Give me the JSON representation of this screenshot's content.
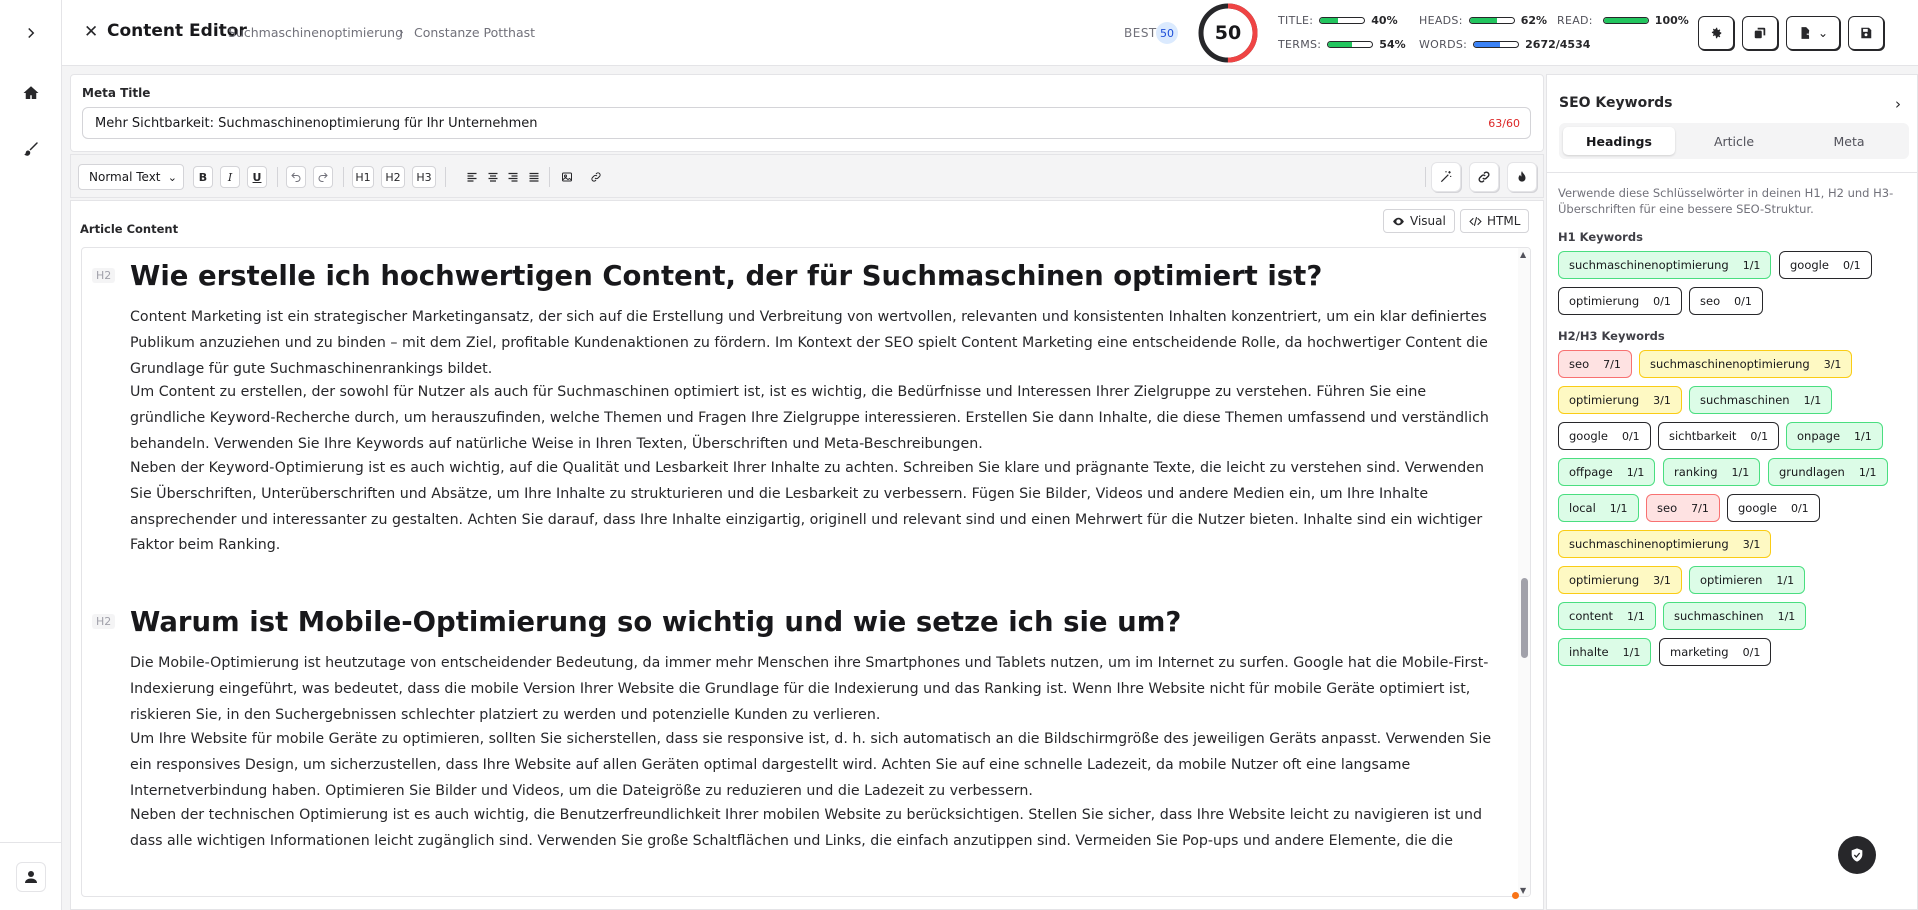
{
  "header": {
    "title": "Content Editor",
    "breadcrumb": [
      "Suchmaschinenoptimierung",
      "Constanze Potthast"
    ],
    "best_label": "BEST",
    "best_value": "50",
    "score": "50",
    "score_fraction": 0.5,
    "metrics": {
      "title": {
        "label": "TITLE:",
        "value": "40%",
        "fill": 0.4
      },
      "terms": {
        "label": "TERMS:",
        "value": "54%",
        "fill": 0.54
      },
      "heads": {
        "label": "HEADS:",
        "value": "62%",
        "fill": 0.62
      },
      "words": {
        "label": "WORDS:",
        "value": "2672/4534",
        "fill": 0.59
      },
      "read": {
        "label": "READ:",
        "value": "100%",
        "fill": 1.0
      }
    }
  },
  "meta": {
    "label": "Meta Title",
    "value": "Mehr Sichtbarkeit: Suchmaschinenoptimierung für Ihr Unternehmen",
    "count": "63/60"
  },
  "toolbar": {
    "style_select": "Normal Text",
    "bold": "B",
    "italic": "I",
    "underline": "U",
    "h1": "H1",
    "h2": "H2",
    "h3": "H3"
  },
  "article": {
    "label": "Article Content",
    "visual_label": "Visual",
    "html_label": "HTML",
    "sections": [
      {
        "tag": "H2",
        "heading": "Wie erstelle ich hochwertigen Content, der für Suchmaschinen optimiert ist?",
        "paragraphs": [
          "Content Marketing ist ein strategischer Marketingansatz, der sich auf die Erstellung und Verbreitung von wertvollen, relevanten und konsistenten Inhalten konzentriert, um ein klar definiertes Publikum anzuziehen und zu binden – mit dem Ziel, profitable Kundenaktionen zu fördern. Im Kontext der SEO spielt Content Marketing eine entscheidende Rolle, da hochwertiger Content die Grundlage für gute Suchmaschinenrankings bildet.",
          "Um Content zu erstellen, der sowohl für Nutzer als auch für Suchmaschinen optimiert ist, ist es wichtig, die Bedürfnisse und Interessen Ihrer Zielgruppe zu verstehen. Führen Sie eine gründliche Keyword-Recherche durch, um herauszufinden, welche Themen und Fragen Ihre Zielgruppe interessieren. Erstellen Sie dann Inhalte, die diese Themen umfassend und verständlich behandeln. Verwenden Sie Ihre Keywords auf natürliche Weise in Ihren Texten, Überschriften und Meta-Beschreibungen.",
          "Neben der Keyword-Optimierung ist es auch wichtig, auf die Qualität und Lesbarkeit Ihrer Inhalte zu achten. Schreiben Sie klare und prägnante Texte, die leicht zu verstehen sind. Verwenden Sie Überschriften, Unterüberschriften und Absätze, um Ihre Inhalte zu strukturieren und die Lesbarkeit zu verbessern. Fügen Sie Bilder, Videos und andere Medien ein, um Ihre Inhalte ansprechender und interessanter zu gestalten. Achten Sie darauf, dass Ihre Inhalte einzigartig, originell und relevant sind und einen Mehrwert für die Nutzer bieten. Inhalte sind ein wichtiger Faktor beim Ranking."
        ]
      },
      {
        "tag": "H2",
        "heading": "Warum ist Mobile-Optimierung so wichtig und wie setze ich sie um?",
        "paragraphs": [
          "Die Mobile-Optimierung ist heutzutage von entscheidender Bedeutung, da immer mehr Menschen ihre Smartphones und Tablets nutzen, um im Internet zu surfen. Google hat die Mobile-First-Indexierung eingeführt, was bedeutet, dass die mobile Version Ihrer Website die Grundlage für die Indexierung und das Ranking ist. Wenn Ihre Website nicht für mobile Geräte optimiert ist, riskieren Sie, in den Suchergebnissen schlechter platziert zu werden und potenzielle Kunden zu verlieren.",
          "Um Ihre Website für mobile Geräte zu optimieren, sollten Sie sicherstellen, dass sie responsive ist, d. h. sich automatisch an die Bildschirmgröße des jeweiligen Geräts anpasst. Verwenden Sie ein responsives Design, um sicherzustellen, dass Ihre Website auf allen Geräten optimal dargestellt wird. Achten Sie auf eine schnelle Ladezeit, da mobile Nutzer oft eine langsame Internetverbindung haben. Optimieren Sie Bilder und Videos, um die Dateigröße zu reduzieren und die Ladezeit zu verbessern.",
          "Neben der technischen Optimierung ist es auch wichtig, die Benutzerfreundlichkeit Ihrer mobilen Website zu berücksichtigen. Stellen Sie sicher, dass Ihre Website leicht zu navigieren ist und dass alle wichtigen Informationen leicht zugänglich sind. Verwenden Sie große Schaltflächen und Links, die einfach anzutippen sind. Vermeiden Sie Pop-ups und andere Elemente, die die"
        ]
      }
    ]
  },
  "seo_panel": {
    "title": "SEO Keywords",
    "tabs": [
      "Headings",
      "Article",
      "Meta"
    ],
    "description": "Verwende diese Schlüsselwörter in deinen H1, H2 und H3-Überschriften für eine bessere SEO-Struktur.",
    "h1_label": "H1 Keywords",
    "h1_keywords": [
      {
        "term": "suchmaschinenoptimierung",
        "count": "1/1",
        "status": "green"
      },
      {
        "term": "google",
        "count": "0/1",
        "status": "white"
      },
      {
        "term": "optimierung",
        "count": "0/1",
        "status": "white"
      },
      {
        "term": "seo",
        "count": "0/1",
        "status": "white"
      }
    ],
    "h23_label": "H2/H3 Keywords",
    "h23_keywords": [
      {
        "term": "seo",
        "count": "7/1",
        "status": "red"
      },
      {
        "term": "suchmaschinenoptimierung",
        "count": "3/1",
        "status": "yellow"
      },
      {
        "term": "optimierung",
        "count": "3/1",
        "status": "yellow"
      },
      {
        "term": "suchmaschinen",
        "count": "1/1",
        "status": "green"
      },
      {
        "term": "google",
        "count": "0/1",
        "status": "white"
      },
      {
        "term": "sichtbarkeit",
        "count": "0/1",
        "status": "white"
      },
      {
        "term": "onpage",
        "count": "1/1",
        "status": "green"
      },
      {
        "term": "offpage",
        "count": "1/1",
        "status": "green"
      },
      {
        "term": "ranking",
        "count": "1/1",
        "status": "green"
      },
      {
        "term": "grundlagen",
        "count": "1/1",
        "status": "green"
      },
      {
        "term": "local",
        "count": "1/1",
        "status": "green"
      },
      {
        "term": "seo",
        "count": "7/1",
        "status": "red"
      },
      {
        "term": "google",
        "count": "0/1",
        "status": "white"
      },
      {
        "term": "suchmaschinenoptimierung",
        "count": "3/1",
        "status": "yellow"
      },
      {
        "term": "optimierung",
        "count": "3/1",
        "status": "yellow"
      },
      {
        "term": "optimieren",
        "count": "1/1",
        "status": "green"
      },
      {
        "term": "content",
        "count": "1/1",
        "status": "green"
      },
      {
        "term": "suchmaschinen",
        "count": "1/1",
        "status": "green"
      },
      {
        "term": "inhalte",
        "count": "1/1",
        "status": "green"
      },
      {
        "term": "marketing",
        "count": "0/1",
        "status": "white"
      }
    ]
  },
  "icons": [
    "chevron-right-icon",
    "home-icon",
    "brush-icon",
    "user-icon",
    "close-icon",
    "settings-icon",
    "copy-icon",
    "export-icon",
    "save-icon",
    "undo-icon",
    "redo-icon",
    "image-icon",
    "link-icon",
    "magic-wand-icon",
    "fire-icon",
    "eye-icon",
    "code-icon",
    "shield-icon"
  ],
  "colors": {
    "green": "#22c55e",
    "blue": "#3b82f6",
    "red": "#dc2626",
    "score_ring": "#ef4444",
    "dark": "#27272a"
  }
}
